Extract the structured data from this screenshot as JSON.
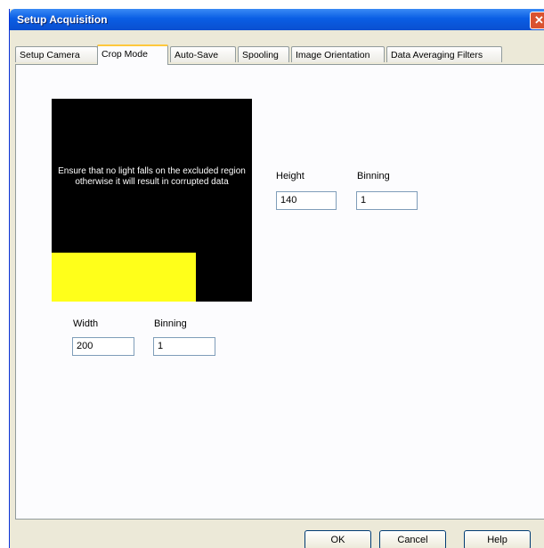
{
  "window": {
    "title": "Setup Acquisition",
    "close_glyph": "✕"
  },
  "tabs": [
    {
      "label": "Setup Camera"
    },
    {
      "label": "Crop Mode"
    },
    {
      "label": "Auto-Save"
    },
    {
      "label": "Spooling"
    },
    {
      "label": "Image Orientation"
    },
    {
      "label": "Data Averaging Filters"
    }
  ],
  "active_tab": "Crop Mode",
  "crop_preview": {
    "message": "Ensure that no light falls on the excluded region otherwise it will result in corrupted data",
    "region_color": "#ffff1a",
    "background_color": "#000000"
  },
  "height_section": {
    "height_label": "Height",
    "height_value": "140",
    "binning_label": "Binning",
    "binning_value": "1"
  },
  "width_section": {
    "width_label": "Width",
    "width_value": "200",
    "binning_label": "Binning",
    "binning_value": "1"
  },
  "buttons": {
    "ok": "OK",
    "cancel": "Cancel",
    "help": "Help"
  }
}
